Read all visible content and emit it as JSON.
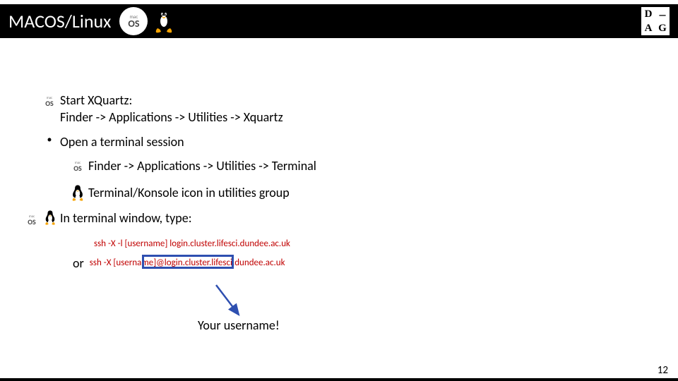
{
  "header": {
    "title": "MACOS/Linux"
  },
  "logo": {
    "a": "D",
    "b": "–",
    "c": "A",
    "d": "G"
  },
  "step_xquartz_title": "Start XQuartz:",
  "step_xquartz_path": "Finder -> Applications -> Utilities -> Xquartz",
  "step_terminal": "Open a terminal session",
  "step_terminal_mac": "Finder -> Applications -> Utilities -> Terminal",
  "step_terminal_linux": "Terminal/Konsole icon in utilities group",
  "step_type": "In terminal window, type:",
  "cmd1": "ssh -X -l [username] login.cluster.lifesci.dundee.ac.uk",
  "or_label": "or",
  "cmd2": "ssh -X [username]@login.cluster.lifesci.dundee.ac.uk",
  "annotation": "Your username!",
  "page_number": "12"
}
